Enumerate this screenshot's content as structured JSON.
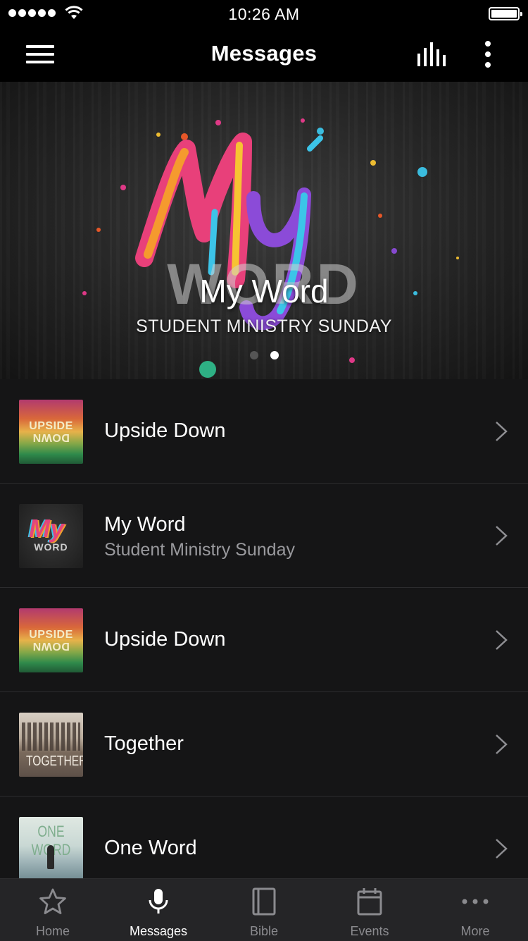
{
  "status_bar": {
    "time": "10:26 AM"
  },
  "nav": {
    "title": "Messages",
    "menu_icon": "hamburger-menu-icon",
    "audio_icon": "audio-bars-icon",
    "more_icon": "vertical-dots-icon"
  },
  "hero": {
    "title": "My Word",
    "subtitle": "STUDENT MINISTRY SUNDAY",
    "artwork_lettering": "My WORD",
    "page_count": 2,
    "active_page": 2
  },
  "messages": [
    {
      "title": "Upside Down",
      "subtitle": "",
      "thumbnail": "upside-down",
      "thumbnail_lettering": "UPSIDE DOWN"
    },
    {
      "title": "My Word",
      "subtitle": "Student Ministry Sunday",
      "thumbnail": "my-word",
      "thumbnail_lettering": "My WORD"
    },
    {
      "title": "Upside Down",
      "subtitle": "",
      "thumbnail": "upside-down",
      "thumbnail_lettering": "UPSIDE DOWN"
    },
    {
      "title": "Together",
      "subtitle": "",
      "thumbnail": "together",
      "thumbnail_lettering": "TOGETHER"
    },
    {
      "title": "One Word",
      "subtitle": "",
      "thumbnail": "one-word",
      "thumbnail_lettering": "ONE WORD"
    }
  ],
  "tabs": [
    {
      "label": "Home",
      "icon": "star-icon",
      "active": false
    },
    {
      "label": "Messages",
      "icon": "microphone-icon",
      "active": true
    },
    {
      "label": "Bible",
      "icon": "book-icon",
      "active": false
    },
    {
      "label": "Events",
      "icon": "calendar-icon",
      "active": false
    },
    {
      "label": "More",
      "icon": "horizontal-dots-icon",
      "active": false
    }
  ],
  "colors": {
    "background": "#151516",
    "bar": "#000000",
    "tab_bar": "#252527",
    "inactive": "#8b8b8f",
    "active": "#ffffff"
  }
}
